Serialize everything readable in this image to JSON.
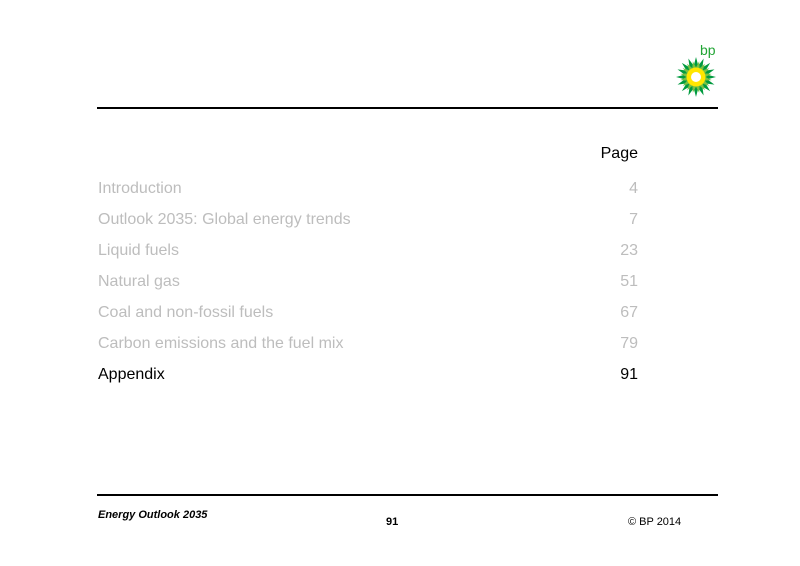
{
  "logo": {
    "text": "bp",
    "icon": "bp-helios-logo-icon",
    "colors": {
      "outer": "#009a3e",
      "mid": "#7ac142",
      "inner": "#ffe600",
      "center": "#ffffff"
    }
  },
  "toc": {
    "header": "Page",
    "items": [
      {
        "title": "Introduction",
        "page": "4"
      },
      {
        "title": "Outlook 2035: Global energy trends",
        "page": "7"
      },
      {
        "title": "Liquid fuels",
        "page": "23"
      },
      {
        "title": "Natural gas",
        "page": "51"
      },
      {
        "title": "Coal and non-fossil fuels",
        "page": "67"
      },
      {
        "title": "Carbon emissions and the fuel mix",
        "page": "79"
      },
      {
        "title": "Appendix",
        "page": "91"
      }
    ],
    "active_index": 6,
    "colors": {
      "inactive": "#bdbdbd",
      "active": "#000000"
    }
  },
  "footer": {
    "title": "Energy Outlook 2035",
    "page_number": "91",
    "copyright": "© BP 2014"
  }
}
